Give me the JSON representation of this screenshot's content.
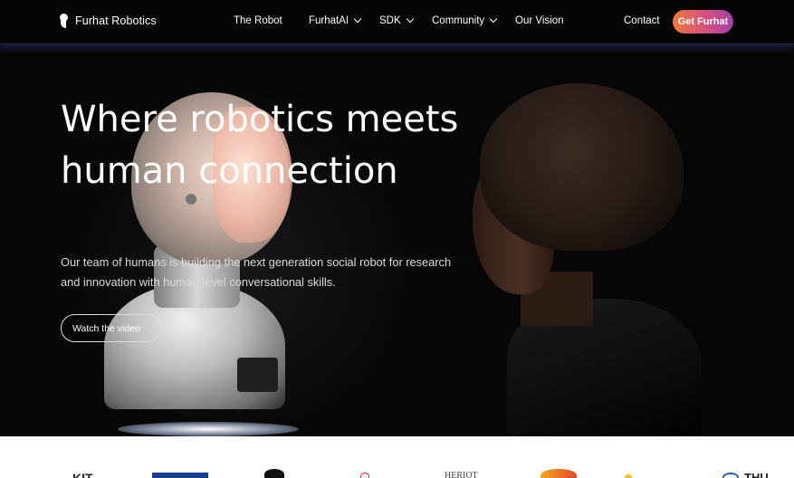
{
  "brand": {
    "name": "Furhat Robotics"
  },
  "nav": {
    "items": [
      {
        "label": "The Robot",
        "dropdown": false
      },
      {
        "label": "FurhatAI",
        "dropdown": true
      },
      {
        "label": "SDK",
        "dropdown": true
      },
      {
        "label": "Community",
        "dropdown": true
      },
      {
        "label": "Our Vision",
        "dropdown": false
      }
    ],
    "contact": "Contact",
    "cta": "Get Furhat"
  },
  "hero": {
    "title_line1": "Where robotics meets",
    "title_line2": "human connection",
    "subtitle_line1": "Our team of humans is building the next generation social robot for research",
    "subtitle_line2": "and innovation with human-level conversational skills.",
    "button": "Watch the video",
    "button_icon": "double-chevron-right-icon"
  },
  "partners": {
    "logos": [
      "KIT",
      "HERIOT",
      "THU"
    ]
  },
  "colors": {
    "cta_gradient_start": "#ee7a3a",
    "cta_gradient_end": "#a43ea8",
    "nav_background": "#050505",
    "hero_background": "#060606"
  }
}
